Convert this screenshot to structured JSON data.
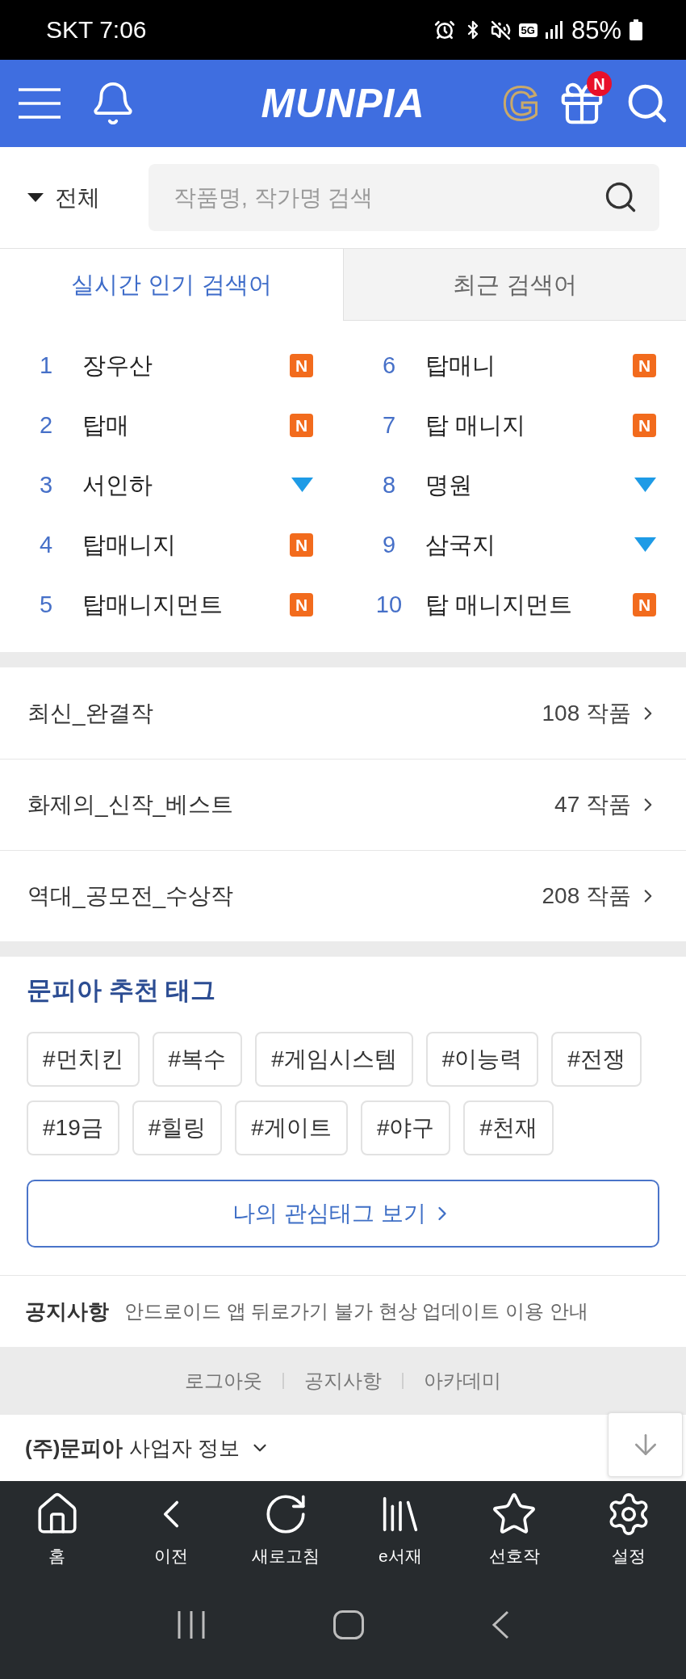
{
  "status_bar": {
    "carrier_time": "SKT 7:06",
    "network": "5G",
    "battery": "85%"
  },
  "header": {
    "logo": "MUNPIA",
    "coin": "G",
    "gift_badge": "N"
  },
  "search": {
    "scope": "전체",
    "placeholder": "작품명, 작가명 검색"
  },
  "tabs": [
    {
      "label": "실시간 인기 검색어",
      "selected": true
    },
    {
      "label": "최근 검색어",
      "selected": false
    }
  ],
  "ranks": [
    {
      "rank": "1",
      "term": "장우산",
      "kind": "new",
      "badge": "N"
    },
    {
      "rank": "2",
      "term": "탑매",
      "kind": "new",
      "badge": "N"
    },
    {
      "rank": "3",
      "term": "서인하",
      "kind": "down"
    },
    {
      "rank": "4",
      "term": "탑매니지",
      "kind": "new",
      "badge": "N"
    },
    {
      "rank": "5",
      "term": "탑매니지먼트",
      "kind": "new",
      "badge": "N"
    },
    {
      "rank": "6",
      "term": "탑매니",
      "kind": "new",
      "badge": "N"
    },
    {
      "rank": "7",
      "term": "탑 매니지",
      "kind": "new",
      "badge": "N"
    },
    {
      "rank": "8",
      "term": "명원",
      "kind": "down"
    },
    {
      "rank": "9",
      "term": "삼국지",
      "kind": "down"
    },
    {
      "rank": "10",
      "term": "탑 매니지먼트",
      "kind": "new",
      "badge": "N"
    }
  ],
  "collections": [
    {
      "title": "최신_완결작",
      "count": "108 작품"
    },
    {
      "title": "화제의_신작_베스트",
      "count": "47 작품"
    },
    {
      "title": "역대_공모전_수상작",
      "count": "208 작품"
    }
  ],
  "recommended_tags": {
    "title": "문피아 추천 태그",
    "tag_rows": [
      [
        "#먼치킨",
        "#복수",
        "#게임시스템",
        "#이능력",
        "#전쟁"
      ],
      [
        "#19금",
        "#힐링",
        "#게이트",
        "#야구",
        "#천재"
      ]
    ],
    "button": "나의 관심태그 보기"
  },
  "notice": {
    "label": "공지사항",
    "text": "안드로이드 앱 뒤로가기 불가 현상 업데이트 이용 안내"
  },
  "footer_links": [
    "로그아웃",
    "공지사항",
    "아카데미"
  ],
  "company_info": "**(주)문피아** 사업자 정보",
  "bottom_nav": [
    {
      "label": "홈"
    },
    {
      "label": "이전"
    },
    {
      "label": "새로고침"
    },
    {
      "label": "e서재"
    },
    {
      "label": "선호작"
    },
    {
      "label": "설정"
    }
  ]
}
